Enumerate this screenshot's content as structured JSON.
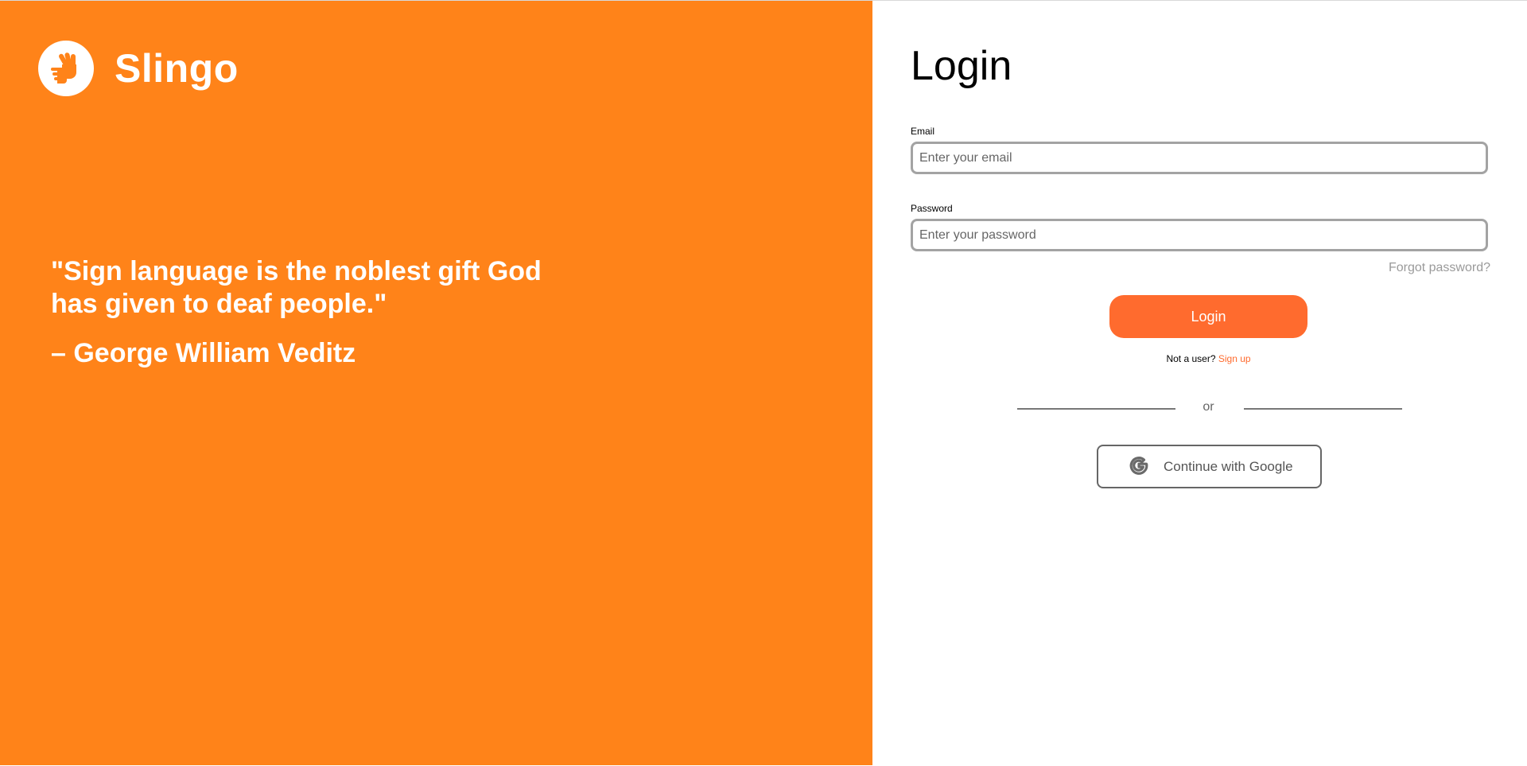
{
  "brand": {
    "name": "Slingo",
    "logo_icon": "sign-language-hand-icon"
  },
  "quote": {
    "text": "\"Sign language is the noblest gift God has given to deaf people.\"",
    "author": "– George William Veditz"
  },
  "login": {
    "title": "Login",
    "email_label": "Email",
    "email_placeholder": "Enter your email",
    "password_label": "Password",
    "password_placeholder": "Enter your password",
    "forgot_password": "Forgot password?",
    "button_label": "Login",
    "not_a_user": "Not a user?",
    "sign_up": "Sign up",
    "divider_text": "or",
    "google_button_label": "Continue with Google",
    "google_icon": "google-icon"
  },
  "colors": {
    "left_panel": "#ff8319",
    "accent": "#ff6b2e"
  }
}
